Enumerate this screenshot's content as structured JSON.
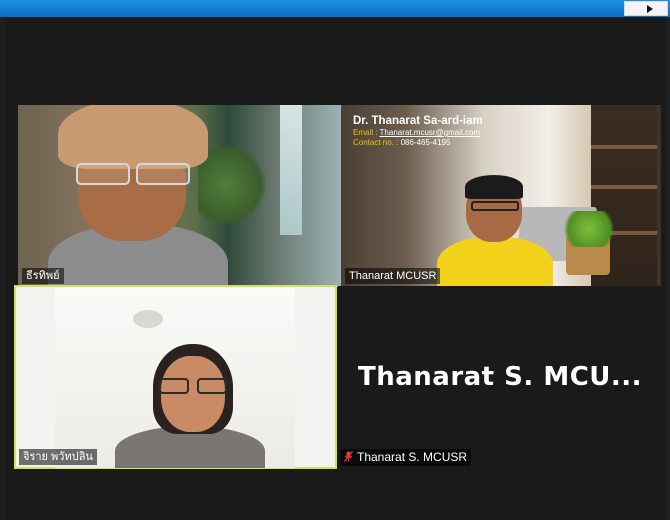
{
  "participants": [
    {
      "id": "p1",
      "name": "ธีรทิพย์",
      "muted": false
    },
    {
      "id": "p2",
      "name": "Thanarat MCUSR",
      "muted": false,
      "overlay": {
        "title": "Dr. Thanarat Sa-ard-iam",
        "email_label": "Email :",
        "email": "Thanarat.mcusr@gmail.com",
        "contact_label": "Contact no. :",
        "contact": "086-465-4195"
      }
    },
    {
      "id": "p3",
      "name": "จิราย พวัทปลิน",
      "muted": false,
      "active_speaker": true
    },
    {
      "id": "p4",
      "name": "Thanarat S. MCUSR",
      "display_name_large": "Thanarat S. MCU...",
      "muted": true,
      "video_off": true
    }
  ],
  "colors": {
    "active_speaker_border": "#d2e25b",
    "mic_off": "#e23b3b",
    "titlebar": "#0a6fc8"
  },
  "icons": {
    "titlebar_arrow": "play-arrow-icon",
    "mic": "mic-off-icon"
  }
}
